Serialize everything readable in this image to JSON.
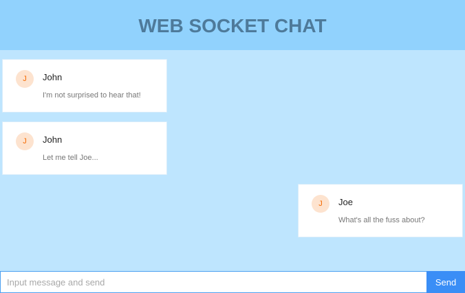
{
  "header": {
    "title": "WEB SOCKET CHAT"
  },
  "messages": [
    {
      "avatar": "J",
      "name": "John",
      "text": "I'm not surprised to hear that!"
    },
    {
      "avatar": "J",
      "name": "John",
      "text": "Let me tell Joe..."
    },
    {
      "avatar": "J",
      "name": "Joe",
      "text": "What's all the fuss about?"
    }
  ],
  "composer": {
    "placeholder": "Input message and send",
    "value": "",
    "send_label": "Send"
  },
  "colors": {
    "header_bg": "#91d2fd",
    "page_bg": "#bee5fe",
    "send_button": "#3a8ef6",
    "avatar_bg": "#fde3cf",
    "avatar_text": "#f56a00"
  }
}
